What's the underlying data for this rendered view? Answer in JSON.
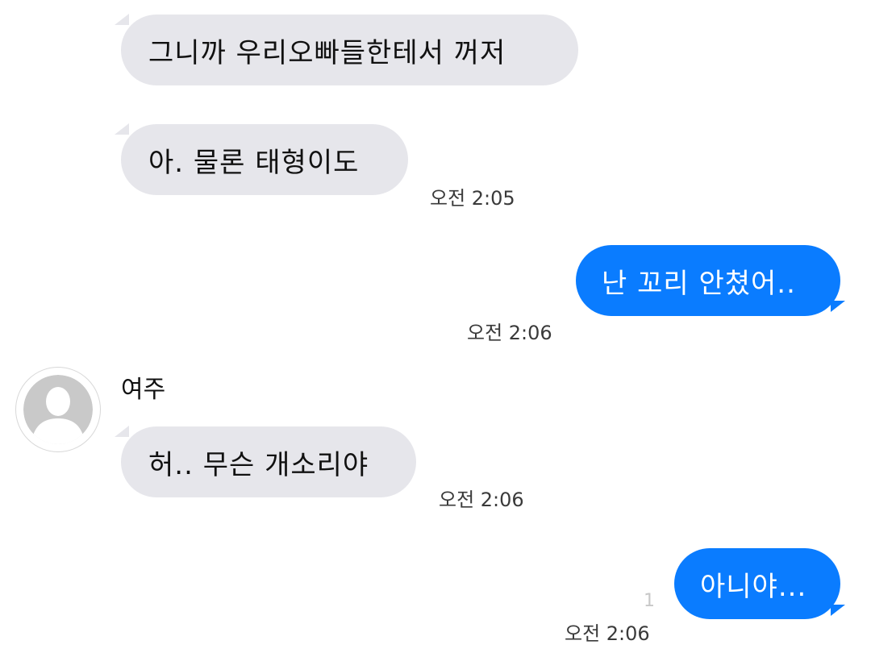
{
  "sender": {
    "name": "여주",
    "avatar_icon": "default-profile-avatar-icon"
  },
  "messages": [
    {
      "direction": "incoming",
      "text": "그니까 우리오빠들한테서 꺼저",
      "time": ""
    },
    {
      "direction": "incoming",
      "text": "아. 물론 태형이도",
      "time": "오전 2:05"
    },
    {
      "direction": "outgoing",
      "text": "난 꼬리 안쳤어..",
      "time": "오전 2:06"
    },
    {
      "direction": "incoming",
      "text": "허.. 무슨 개소리야",
      "time": "오전 2:06"
    },
    {
      "direction": "outgoing",
      "text": "아니야...",
      "time": "오전 2:06",
      "unread_count": "1"
    }
  ],
  "colors": {
    "incoming_bubble": "#e6e6eb",
    "outgoing_bubble": "#0a7cff",
    "outgoing_text": "#ffffff",
    "incoming_text": "#111111"
  }
}
